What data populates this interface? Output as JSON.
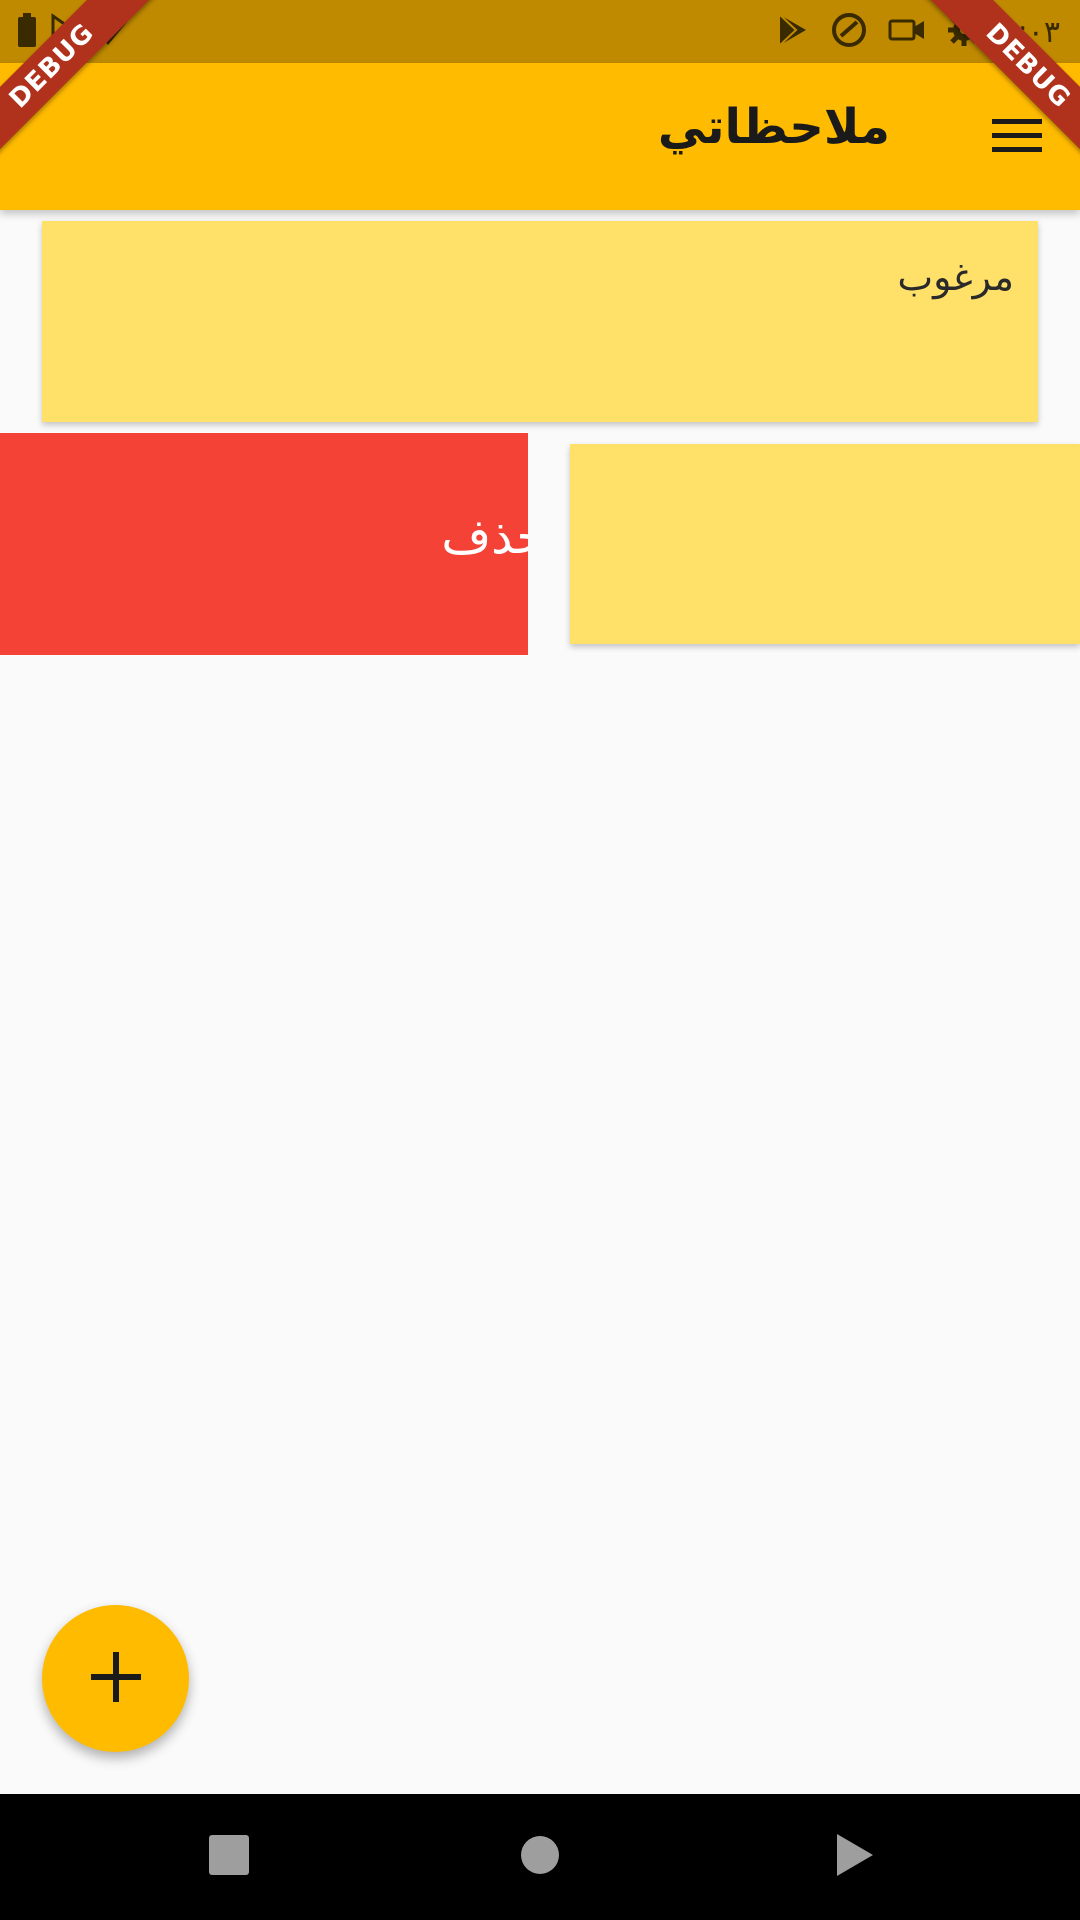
{
  "status_bar": {
    "time": "٧:٠٣",
    "icons": [
      "battery-icon",
      "signal-icon",
      "wifi-icon",
      "play-store-icon",
      "sync-icon",
      "video-icon",
      "settings-icon"
    ]
  },
  "app_bar": {
    "title": "ملاحظاتي",
    "menu_icon": "menu-icon"
  },
  "notes": [
    {
      "text": "مرغوب",
      "color": "#FFE16A"
    },
    {
      "text": "",
      "color": "#FFE16A"
    }
  ],
  "dismiss_background": {
    "text": "حذف",
    "color": "#F44336"
  },
  "debug_banner": "DEBUG",
  "fab": {
    "icon": "plus-icon",
    "color": "#FFBB00"
  },
  "nav_bar": {
    "buttons": [
      "recents-button",
      "home-button",
      "back-button"
    ]
  },
  "colors": {
    "primary": "#FFBB00",
    "status_bar": "#BF8A00",
    "background": "#FAFAFA"
  }
}
